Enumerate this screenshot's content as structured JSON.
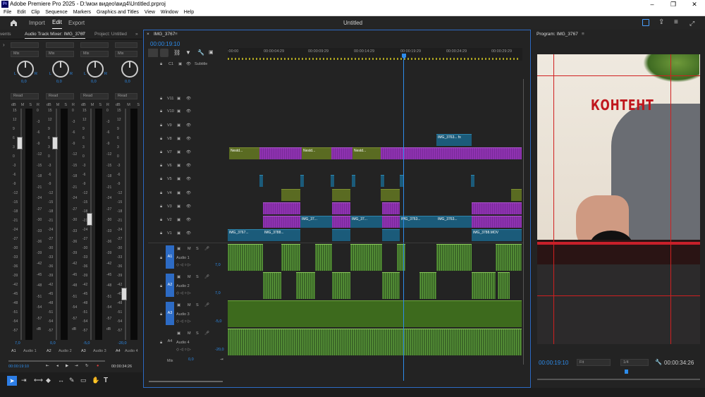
{
  "window": {
    "title": "Adobe Premiere Pro 2025 - D:\\мои видео\\вид4\\Untitled.prproj",
    "min": "–",
    "max": "❐",
    "close": "✕",
    "logo": "Pr"
  },
  "menu": [
    "File",
    "Edit",
    "Clip",
    "Sequence",
    "Markers",
    "Graphics and Titles",
    "View",
    "Window",
    "Help"
  ],
  "topbar": {
    "tabs": [
      "Import",
      "Edit",
      "Export"
    ],
    "active": "Edit",
    "project_title": "Untitled"
  },
  "mixer": {
    "tabs": [
      "vents",
      "Audio Track Mixer: IMG_3767",
      "Project: Untitled"
    ],
    "channels": [
      {
        "mode": "Mix",
        "pan_value": "0,0",
        "read": "Read",
        "name": "A1",
        "label": "Audio 1",
        "level": "7,0"
      },
      {
        "mode": "Mix",
        "pan_value": "0,0",
        "read": "Read",
        "name": "A2",
        "label": "Audio 2",
        "level": "0,0"
      },
      {
        "mode": "Mix",
        "pan_value": "0,0",
        "read": "Read",
        "name": "A3",
        "label": "Audio 3",
        "level": "-5,0"
      },
      {
        "mode": "Mix",
        "pan_value": "0,0",
        "read": "Read",
        "name": "A4",
        "label": "Audio 4",
        "level": "-20,0"
      }
    ],
    "pan_letters": {
      "l": "L",
      "r": "R"
    },
    "msr": [
      "M",
      "S",
      "R"
    ],
    "db_label": "dB",
    "scale_left": [
      "15",
      "12",
      "9",
      "6",
      "3",
      "0",
      "-3",
      "-6",
      "-9",
      "-12",
      "-15",
      "-18",
      "-21",
      "-24",
      "-27",
      "-30",
      "-33",
      "-36",
      "-39",
      "-42",
      "-45",
      "-48",
      "-51",
      "-54",
      "-57"
    ],
    "scale_right": [
      "0",
      "-3",
      "-6",
      "-9",
      "-12",
      "-15",
      "-18",
      "-21",
      "-24",
      "-27",
      "-30",
      "-33",
      "-36",
      "-39",
      "-42",
      "-45",
      "-48",
      "-51",
      "-54",
      "-57",
      "dB"
    ],
    "timecode_left": "00:00:19:10",
    "timecode_right": "00:00:34:26"
  },
  "timeline": {
    "tab": "IMG_3767",
    "timecode": "00:00:19:10",
    "ruler": [
      ":00:00",
      "00:00:04:29",
      "00:00:09:29",
      "00:00:14:29",
      "00:00:19:29",
      "00:00:24:29",
      "00:00:29:29"
    ],
    "subtitle_track": {
      "name": "C1",
      "label": "Subtitle"
    },
    "video_tracks": [
      "V11",
      "V10",
      "V9",
      "V8",
      "V7",
      "V6",
      "V5",
      "V4",
      "V3",
      "V2",
      "V1"
    ],
    "audio_tracks": [
      {
        "id": "A1",
        "name": "Audio 1",
        "vol": "7,0"
      },
      {
        "id": "A2",
        "name": "Audio 2",
        "vol": "7,0"
      },
      {
        "id": "A3",
        "name": "Audio 3",
        "vol": "-5,0"
      },
      {
        "id": "A4",
        "name": "Audio 4",
        "vol": "-20,0"
      }
    ],
    "mix": {
      "label": "Mix",
      "value": "0,0"
    },
    "clip_labels": {
      "v8": "IMG_3763...",
      "v7a": "Nestd...",
      "v7b": "Nestd...",
      "v7c": "Nestd...",
      "v2a": "IMG_37...",
      "v2b": "IMG_37...",
      "v2c": "IMG_3763...",
      "v2d": "IMG_3763...",
      "v1a": "IMG_3767...",
      "v1b": "IMG_3788...",
      "v1c": "IMG_3788.MOV",
      "fx": "fx"
    }
  },
  "program": {
    "tab": "Program: IMG_3767",
    "overlay_text": "КОНТЕНТ",
    "timecode": "00:00:19:10",
    "fit": "Fit",
    "quality": "1/4",
    "duration": "00:00:34:26"
  }
}
